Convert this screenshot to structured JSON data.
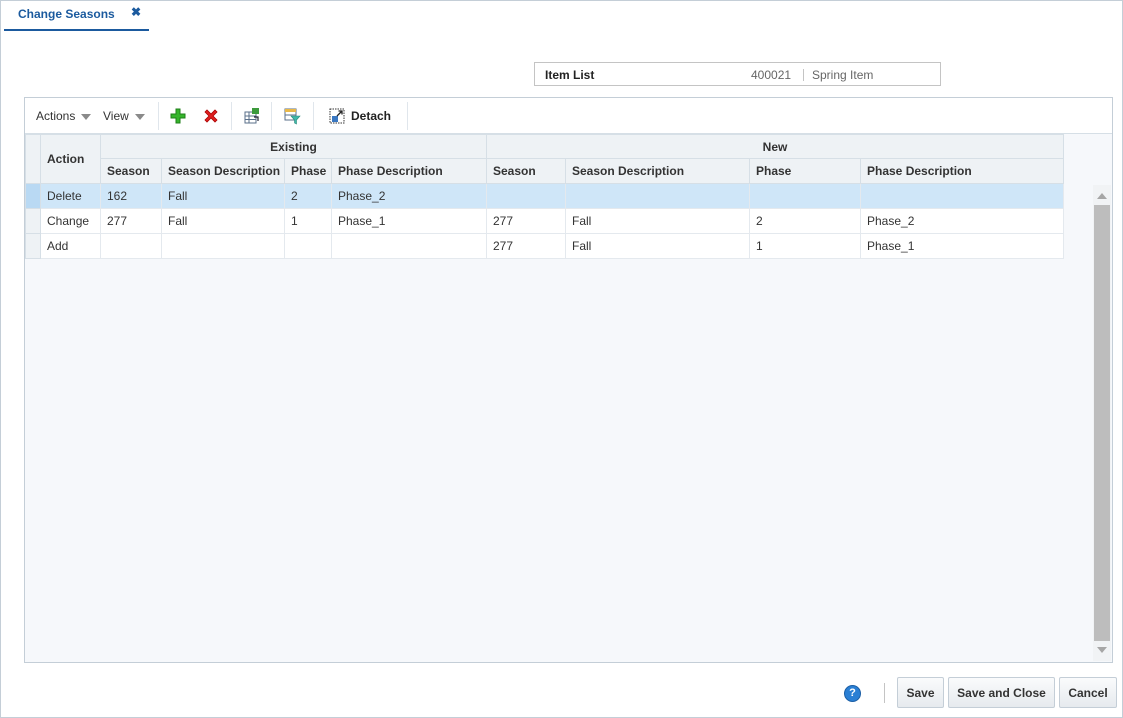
{
  "tab": {
    "label": "Change Seasons",
    "close_glyph": "✖"
  },
  "item_list": {
    "label": "Item List",
    "item_number": "400021",
    "item_description": "Spring Item"
  },
  "toolbar": {
    "actions_label": "Actions",
    "view_label": "View",
    "add_icon": "plus-icon",
    "delete_icon": "delete-x-icon",
    "export_icon": "export-excel-icon",
    "filter_icon": "query-by-example-icon",
    "detach_label": "Detach"
  },
  "table": {
    "action_header": "Action",
    "group_headers": {
      "existing": "Existing",
      "new": "New"
    },
    "columns": {
      "existing_season": "Season",
      "existing_season_desc": "Season Description",
      "existing_phase": "Phase",
      "existing_phase_desc": "Phase Description",
      "new_season": "Season",
      "new_season_desc": "Season Description",
      "new_phase": "Phase",
      "new_phase_desc": "Phase Description"
    },
    "rows": [
      {
        "action": "Delete",
        "ex_season": "162",
        "ex_season_desc": "Fall",
        "ex_phase": "2",
        "ex_phase_desc": "Phase_2",
        "new_season": "",
        "new_season_desc": "",
        "new_phase": "",
        "new_phase_desc": "",
        "selected": true
      },
      {
        "action": "Change",
        "ex_season": "277",
        "ex_season_desc": "Fall",
        "ex_phase": "1",
        "ex_phase_desc": "Phase_1",
        "new_season": "277",
        "new_season_desc": "Fall",
        "new_phase": "2",
        "new_phase_desc": "Phase_2",
        "selected": false
      },
      {
        "action": "Add",
        "ex_season": "",
        "ex_season_desc": "",
        "ex_phase": "",
        "ex_phase_desc": "",
        "new_season": "277",
        "new_season_desc": "Fall",
        "new_phase": "1",
        "new_phase_desc": "Phase_1",
        "selected": false
      }
    ]
  },
  "footer": {
    "help_glyph": "?",
    "save_label": "Save",
    "save_close_label": "Save and Close",
    "cancel_label": "Cancel"
  }
}
